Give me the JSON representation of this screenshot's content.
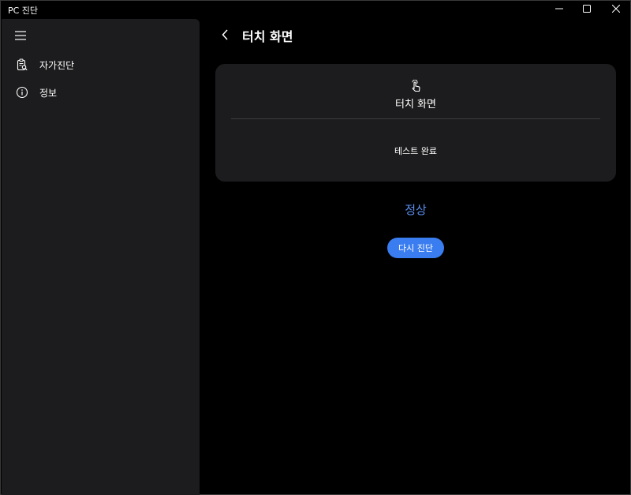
{
  "window": {
    "title": "PC 진단",
    "controls": {
      "minimize_icon": "minimize-icon",
      "maximize_icon": "maximize-icon",
      "close_icon": "close-icon"
    }
  },
  "sidebar": {
    "menu_icon": "hamburger-icon",
    "items": [
      {
        "label": "자가진단",
        "icon": "clipboard-search-icon"
      },
      {
        "label": "정보",
        "icon": "info-icon"
      }
    ]
  },
  "header": {
    "back_icon": "chevron-left-icon",
    "title": "터치 화면"
  },
  "card": {
    "icon": "touch-hand-icon",
    "title": "터치 화면",
    "status": "테스트 완료"
  },
  "result": {
    "label": "정상"
  },
  "actions": {
    "retry_label": "다시 진단"
  },
  "colors": {
    "background": "#000000",
    "panel": "#1c1c1e",
    "accent": "#3a7df0",
    "result_text": "#5b8ff0"
  }
}
